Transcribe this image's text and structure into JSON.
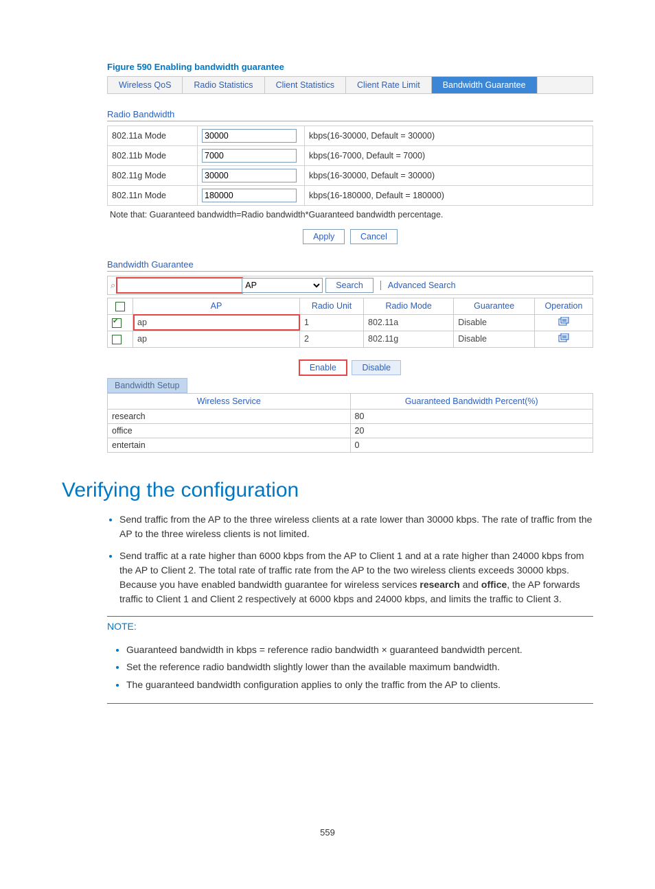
{
  "figure_caption": "Figure 590 Enabling bandwidth guarantee",
  "tabs": {
    "t0": "Wireless QoS",
    "t1": "Radio Statistics",
    "t2": "Client Statistics",
    "t3": "Client Rate Limit",
    "t4": "Bandwidth Guarantee"
  },
  "radio_bandwidth": {
    "title": "Radio Bandwidth",
    "rows": [
      {
        "label": "802.11a Mode",
        "value": "30000",
        "hint": "kbps(16-30000, Default = 30000)"
      },
      {
        "label": "802.11b Mode",
        "value": "7000",
        "hint": "kbps(16-7000, Default = 7000)"
      },
      {
        "label": "802.11g Mode",
        "value": "30000",
        "hint": "kbps(16-30000, Default = 30000)"
      },
      {
        "label": "802.11n Mode",
        "value": "180000",
        "hint": "kbps(16-180000, Default = 180000)"
      }
    ],
    "note": "Note that: Guaranteed bandwidth=Radio bandwidth*Guaranteed bandwidth percentage.",
    "apply": "Apply",
    "cancel": "Cancel"
  },
  "bandwidth_guarantee": {
    "title": "Bandwidth Guarantee",
    "search_icon": "⌕",
    "search_value": "",
    "select_value": "AP",
    "search_btn": "Search",
    "advanced": "Advanced Search",
    "headers": {
      "ap": "AP",
      "radio_unit": "Radio Unit",
      "radio_mode": "Radio Mode",
      "guarantee": "Guarantee",
      "operation": "Operation"
    },
    "rows": [
      {
        "ap": "ap",
        "unit": "1",
        "mode": "802.11a",
        "guar": "Disable"
      },
      {
        "ap": "ap",
        "unit": "2",
        "mode": "802.11g",
        "guar": "Disable"
      }
    ],
    "enable": "Enable",
    "disable": "Disable",
    "setup_tab": "Bandwidth Setup",
    "setup_headers": {
      "ws": "Wireless Service",
      "pct": "Guaranteed Bandwidth Percent(%)"
    },
    "setup_rows": [
      {
        "ws": "research",
        "pct": "80"
      },
      {
        "ws": "office",
        "pct": "20"
      },
      {
        "ws": "entertain",
        "pct": "0"
      }
    ]
  },
  "verify_heading": "Verifying the configuration",
  "verify_bullets": {
    "b0": "Send traffic from the AP to the three wireless clients at a rate lower than 30000 kbps. The rate of traffic from the AP to the three wireless clients is not limited.",
    "b1_a": "Send traffic at a rate higher than 6000 kbps from the AP to Client 1 and at a rate higher than 24000 kbps from the AP to Client 2. The total rate of traffic rate from the AP to the two wireless clients exceeds 30000 kbps. Because you have enabled bandwidth guarantee for wireless services ",
    "b1_bold1": "research",
    "b1_mid": " and ",
    "b1_bold2": "office",
    "b1_b": ", the AP forwards traffic to Client 1 and Client 2 respectively at 6000 kbps and 24000 kbps, and limits the traffic to Client 3."
  },
  "note": {
    "title": "NOTE:",
    "n0": "Guaranteed bandwidth in kbps = reference radio bandwidth × guaranteed bandwidth percent.",
    "n1": "Set the reference radio bandwidth slightly lower than the available maximum bandwidth.",
    "n2": "The guaranteed bandwidth configuration applies to only the traffic from the AP to clients."
  },
  "page_number": "559"
}
